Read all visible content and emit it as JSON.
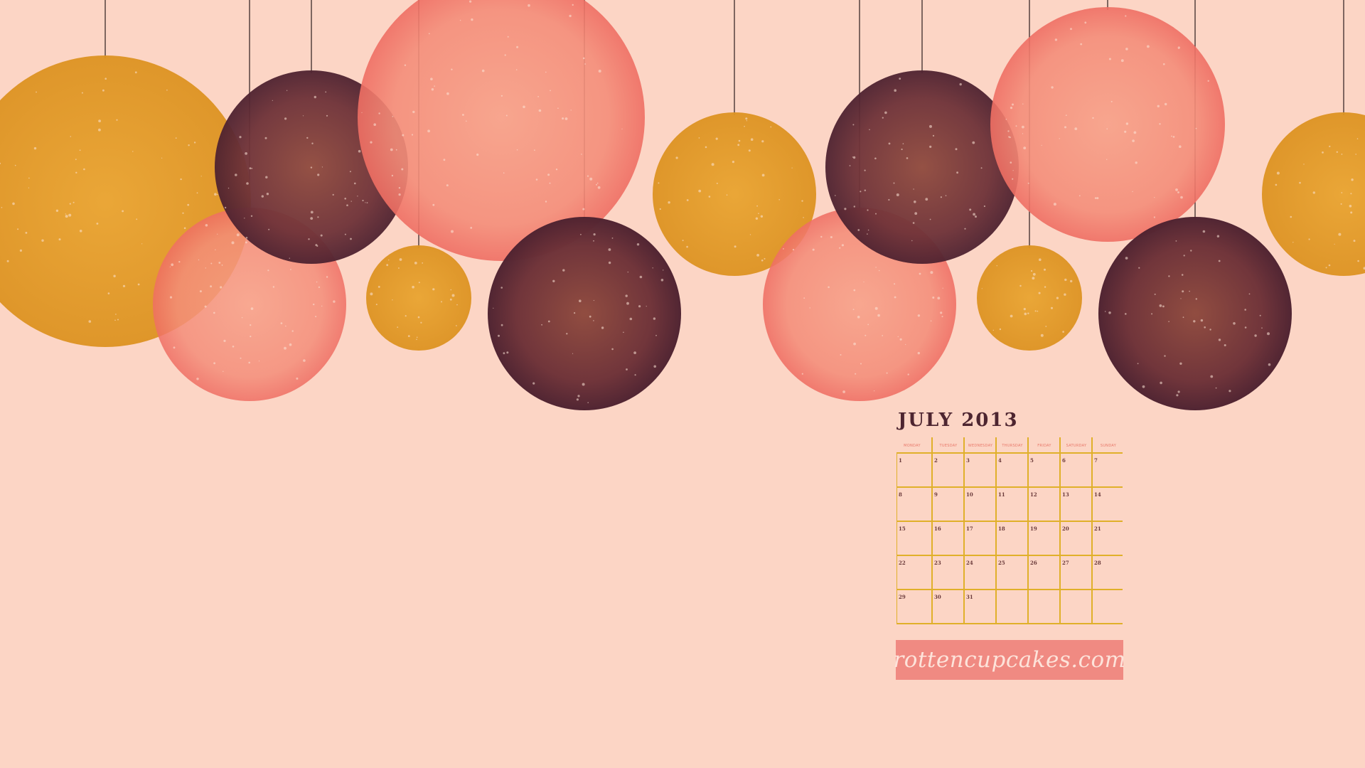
{
  "calendar": {
    "title": "JULY 2013",
    "weekdays": [
      "MONDAY",
      "TUESDAY",
      "WEDNESDAY",
      "THURSDAY",
      "FRIDAY",
      "SATURDAY",
      "SUNDAY"
    ],
    "weeks": [
      [
        "1",
        "2",
        "3",
        "4",
        "5",
        "6",
        "7"
      ],
      [
        "8",
        "9",
        "10",
        "11",
        "12",
        "13",
        "14"
      ],
      [
        "15",
        "16",
        "17",
        "18",
        "19",
        "20",
        "21"
      ],
      [
        "22",
        "23",
        "24",
        "25",
        "26",
        "27",
        "28"
      ],
      [
        "29",
        "30",
        "31",
        "",
        "",
        "",
        ""
      ]
    ]
  },
  "site": {
    "label": "rottencupcakes.com"
  },
  "colors": {
    "background": "#fcd5c5",
    "mustard": "#e49a22",
    "coral": "#f47d6e",
    "plum": "#5e2a35",
    "grid_line": "#e0b02a",
    "badge": "#f08a82"
  }
}
